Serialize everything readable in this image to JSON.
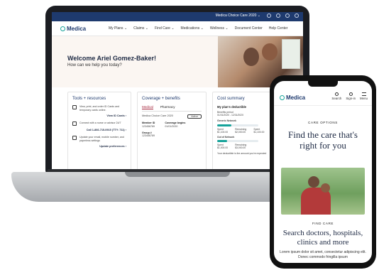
{
  "laptop": {
    "utility_bar": {
      "plan_selector": "Medica Choice Care 2020 ⌄",
      "icons": [
        "notification-icon",
        "help-icon",
        "settings-icon",
        "account-icon"
      ]
    },
    "nav": {
      "logo": "Medica",
      "links": [
        "My Plans ⌄",
        "Claims ⌄",
        "Find Care ⌄",
        "Medications ⌄",
        "Wellness ⌄",
        "Document Center",
        "Help Center"
      ]
    },
    "hero": {
      "title": "Welcome Ariel Gomez-Baker!",
      "subtitle": "How can we help you today?"
    },
    "tools": {
      "title": "Tools + resources",
      "items": [
        {
          "icon": "id-card-icon",
          "text": "View, print, and order ID Cards and temporary cards online.",
          "link": "View ID Cards ›"
        },
        {
          "icon": "phone-icon",
          "text": "Connect with a nurse or advisor 24/7",
          "link": "Call 1-866-715-0915 (TTY: 711) ›"
        },
        {
          "icon": "profile-icon",
          "text": "Update your email, mobile number, and paperless settings",
          "link": "Update preferences ›"
        }
      ]
    },
    "coverage": {
      "title": "Coverage + benefits",
      "tabs": [
        "Medical",
        "Pharmacy"
      ],
      "plan": "Medica Choice Care 2020",
      "status": "Active",
      "member_id_label": "Member ID",
      "member_id": "123456789",
      "coverage_begins_label": "Coverage begins",
      "coverage_begins": "01/01/2020",
      "group_label": "Group #",
      "group": "123456789"
    },
    "cost": {
      "title": "Cost summary",
      "deductible_title": "My plan's deductible",
      "benefits_period_label": "Benefits period",
      "benefits_period": "01/01/2020 - 12/31/2020",
      "in_network_label": "Generic Network",
      "medica_network_label": "Medica Netw",
      "spent_label": "Spent",
      "spent_value": "$1,100.00",
      "remaining_label": "Remaining",
      "remaining_value": "$2,000.00",
      "spent2_value": "$1,100.00",
      "out_network_label": "Out of Network",
      "spent3_value": "$1,000.00",
      "remaining3_value": "$3,000.00",
      "in_network_progress": 0.35,
      "out_network_progress": 0.25,
      "footnote": "Your deductible is the amount you're expected"
    }
  },
  "phone": {
    "logo": "Medica",
    "header_actions": [
      "Search",
      "Sign-in",
      "Menu"
    ],
    "eyebrow": "CARE OPTIONS",
    "title": "Find the care that's right for you",
    "section_eyebrow": "FIND CARE",
    "section_title": "Search doctors, hospitals, clinics and more",
    "body": "Lorem ipsum dolor sit amet, consectetur adipiscing elit. Donec commodo fringilla ipsum"
  }
}
